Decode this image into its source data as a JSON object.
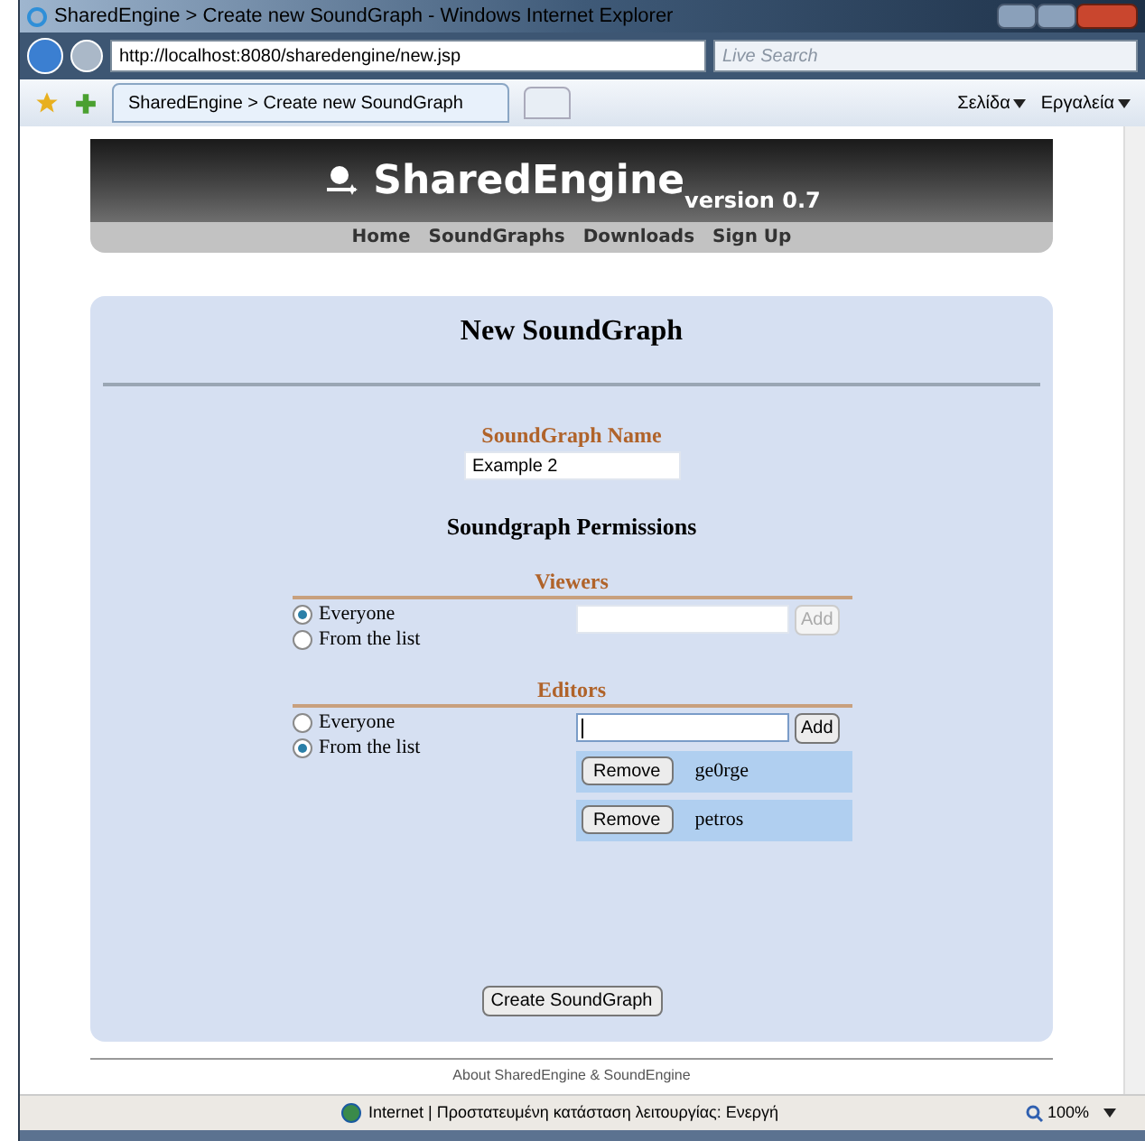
{
  "window": {
    "title": "SharedEngine > Create new SoundGraph - Windows Internet Explorer"
  },
  "address_bar": {
    "url": "http://localhost:8080/sharedengine/new.jsp",
    "search_placeholder": "Live Search"
  },
  "tab": {
    "label": "SharedEngine > Create new SoundGraph",
    "selected": true
  },
  "command_bar": [
    "Σελίδα",
    "Εργαλεία"
  ],
  "header": {
    "brand": "SharedEngine",
    "version": "version 0.7",
    "nav": [
      "Home",
      "SoundGraphs",
      "Downloads",
      "Sign Up"
    ]
  },
  "form": {
    "title": "New SoundGraph",
    "name_label": "SoundGraph Name",
    "name_value": "Example 2",
    "permissions_title": "Soundgraph Permissions",
    "sections": [
      {
        "label": "Viewers",
        "options": [
          {
            "label": "Everyone",
            "selected": true
          },
          {
            "label": "From the list",
            "selected": false
          }
        ],
        "add_button": "Add",
        "add_disabled": true,
        "focused": false
      },
      {
        "label": "Editors",
        "options": [
          {
            "label": "Everyone",
            "selected": false
          },
          {
            "label": "From the list",
            "selected": true
          }
        ],
        "add_button": "Add",
        "add_disabled": false,
        "focused": true,
        "users": [
          {
            "name": "ge0rge",
            "button": "Remove"
          },
          {
            "name": "petros",
            "button": "Remove"
          }
        ]
      }
    ],
    "submit": "Create SoundGraph"
  },
  "footer": "About SharedEngine & SoundEngine",
  "status_bar": {
    "text": "Internet | Προστατευμένη κατάσταση λειτουργίας: Ενεργή",
    "zoom": "100%"
  }
}
